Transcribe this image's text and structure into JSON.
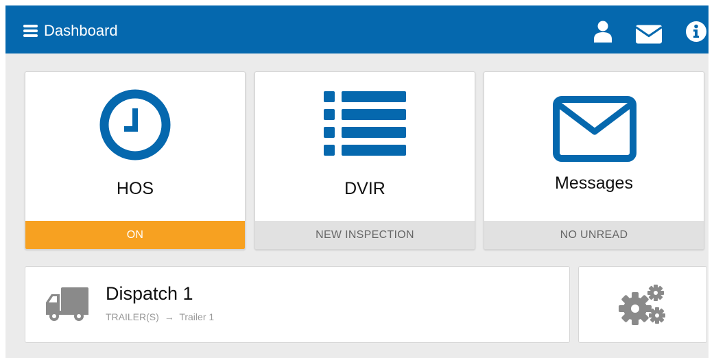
{
  "header": {
    "title": "Dashboard",
    "bg_color": "#0568ae",
    "icons": [
      "menu-icon",
      "user-icon",
      "envelope-icon",
      "info-icon"
    ]
  },
  "tiles": [
    {
      "label": "HOS",
      "status": "ON",
      "icon": "clock-icon",
      "status_color": "#f7a121"
    },
    {
      "label": "DVIR",
      "status": "NEW INSPECTION",
      "icon": "list-icon"
    },
    {
      "label": "Messages",
      "status": "NO UNREAD",
      "icon": "envelope-icon"
    }
  ],
  "dispatch": {
    "title": "Dispatch 1",
    "trailers_label": "TRAILER(S)",
    "arrow": "→",
    "trailer": "Trailer 1",
    "icon": "truck-icon"
  },
  "settings": {
    "icon": "gears-icon"
  },
  "colors": {
    "accent": "#0568ae",
    "on": "#f7a121",
    "icon_gray": "#8a8a8a"
  }
}
